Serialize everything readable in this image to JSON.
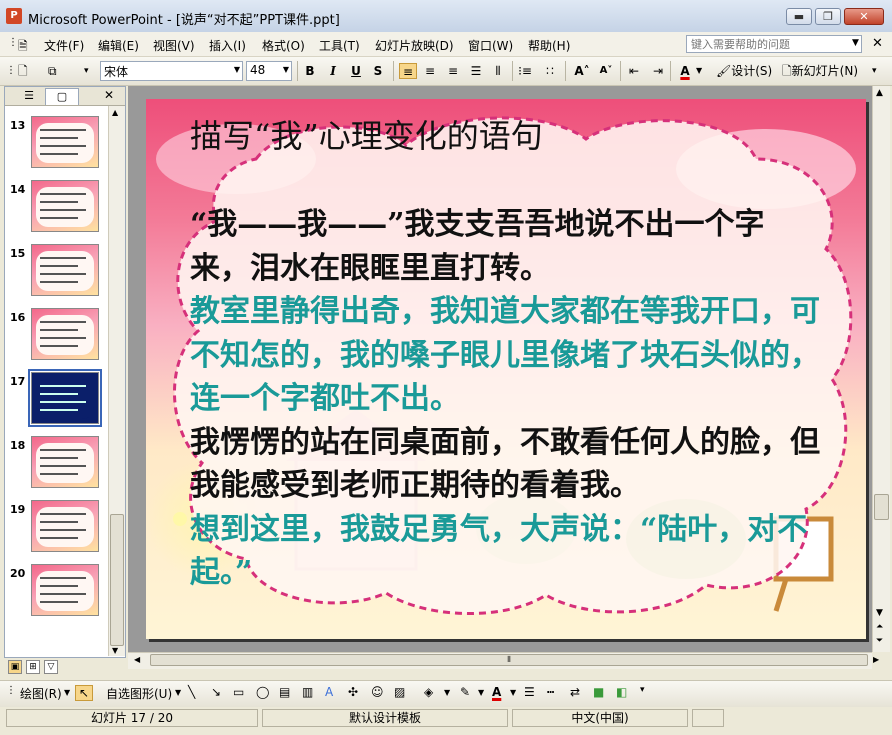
{
  "window": {
    "app_icon_letter": "P",
    "title": "Microsoft PowerPoint - [说声“对不起”PPT课件.ppt]",
    "min_glyph": "▬",
    "max_glyph": "❐",
    "close_glyph": "✕"
  },
  "menu": {
    "items": [
      "文件(F)",
      "编辑(E)",
      "视图(V)",
      "插入(I)",
      "格式(O)",
      "工具(T)",
      "幻灯片放映(D)",
      "窗口(W)",
      "帮助(H)"
    ],
    "help_placeholder": "键入需要帮助的问题",
    "dropdown_glyph": "▼",
    "doc_close_glyph": "✕"
  },
  "toolbar": {
    "font_name": "宋体",
    "font_size": "48",
    "bold": "B",
    "italic": "I",
    "underline": "U",
    "shadow": "S",
    "font_grow": "A˄",
    "font_shrink": "A˅",
    "font_color": "A",
    "design_label": "设计(S)",
    "new_slide_label": "新幻灯片(N)"
  },
  "left_pane": {
    "tab_outline": "☰",
    "tab_slides": "▢",
    "close_glyph": "✕",
    "thumbnails": [
      {
        "num": "13"
      },
      {
        "num": "14"
      },
      {
        "num": "15"
      },
      {
        "num": "16"
      },
      {
        "num": "17"
      },
      {
        "num": "18"
      },
      {
        "num": "19"
      },
      {
        "num": "20"
      }
    ],
    "selected_index": 4
  },
  "slide": {
    "title": "描写“我”心理变化的语句",
    "paragraphs": [
      {
        "text": "“我——我——”我支支吾吾地说不出一个字来，泪水在眼眶里直打转。",
        "color": "#111111"
      },
      {
        "text": "教室里静得出奇，我知道大家都在等我开口，可不知怎的，我的嗓子眼儿里像堵了块石头似的，连一个字都吐不出。",
        "color": "#1a9a98"
      },
      {
        "text": "我愣愣的站在同桌面前，不敢看任何人的脸，但我能感受到老师正期待的看着我。",
        "color": "#111111"
      },
      {
        "text": "想到这里，我鼓足勇气，大声说：“陆叶，对不起。”",
        "color": "#1a9a98"
      }
    ]
  },
  "draw_toolbar": {
    "draw_label": "绘图(R)",
    "autoshape_label": "自选图形(U)"
  },
  "status": {
    "slide_counter": "幻灯片 17 / 20",
    "template": "默认设计模板",
    "language": "中文(中国)"
  },
  "colors": {
    "accent_teal": "#1a9a98",
    "slide_pink": "#ee4f7a",
    "cloud_border": "#d6307a"
  }
}
